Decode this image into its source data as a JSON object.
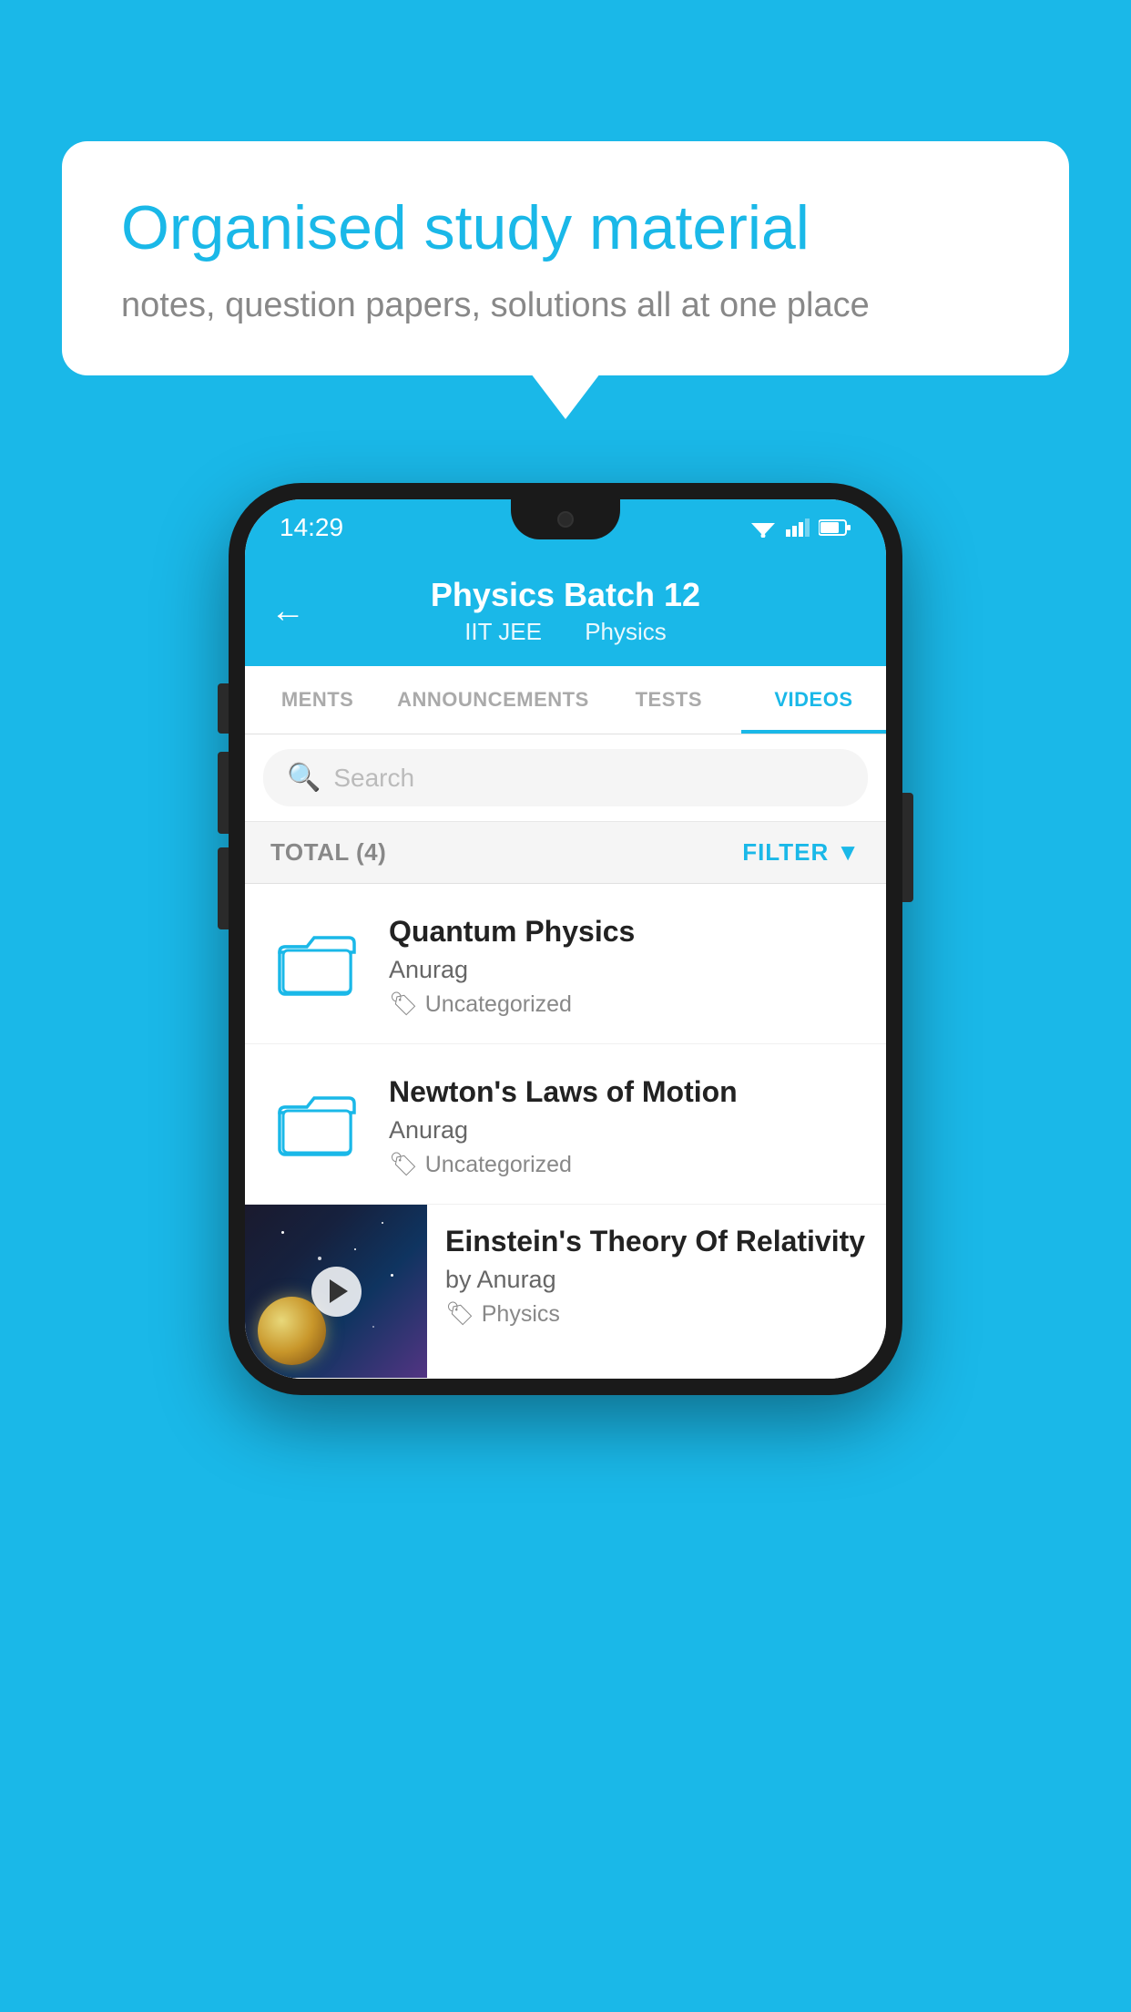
{
  "background_color": "#1ab8e8",
  "speech_bubble": {
    "title": "Organised study material",
    "subtitle": "notes, question papers, solutions all at one place"
  },
  "phone": {
    "status_bar": {
      "time": "14:29",
      "wifi": "▼▲",
      "battery": "battery"
    },
    "header": {
      "back_label": "←",
      "title": "Physics Batch 12",
      "subtitle_part1": "IIT JEE",
      "subtitle_part2": "Physics"
    },
    "tabs": [
      {
        "label": "MENTS",
        "active": false
      },
      {
        "label": "ANNOUNCEMENTS",
        "active": false
      },
      {
        "label": "TESTS",
        "active": false
      },
      {
        "label": "VIDEOS",
        "active": true
      }
    ],
    "search": {
      "placeholder": "Search"
    },
    "filter_bar": {
      "total_label": "TOTAL (4)",
      "filter_label": "FILTER"
    },
    "videos": [
      {
        "title": "Quantum Physics",
        "author": "Anurag",
        "tag": "Uncategorized",
        "type": "folder"
      },
      {
        "title": "Newton's Laws of Motion",
        "author": "Anurag",
        "tag": "Uncategorized",
        "type": "folder"
      },
      {
        "title": "Einstein's Theory Of Relativity",
        "author": "by Anurag",
        "tag": "Physics",
        "type": "video"
      }
    ]
  }
}
